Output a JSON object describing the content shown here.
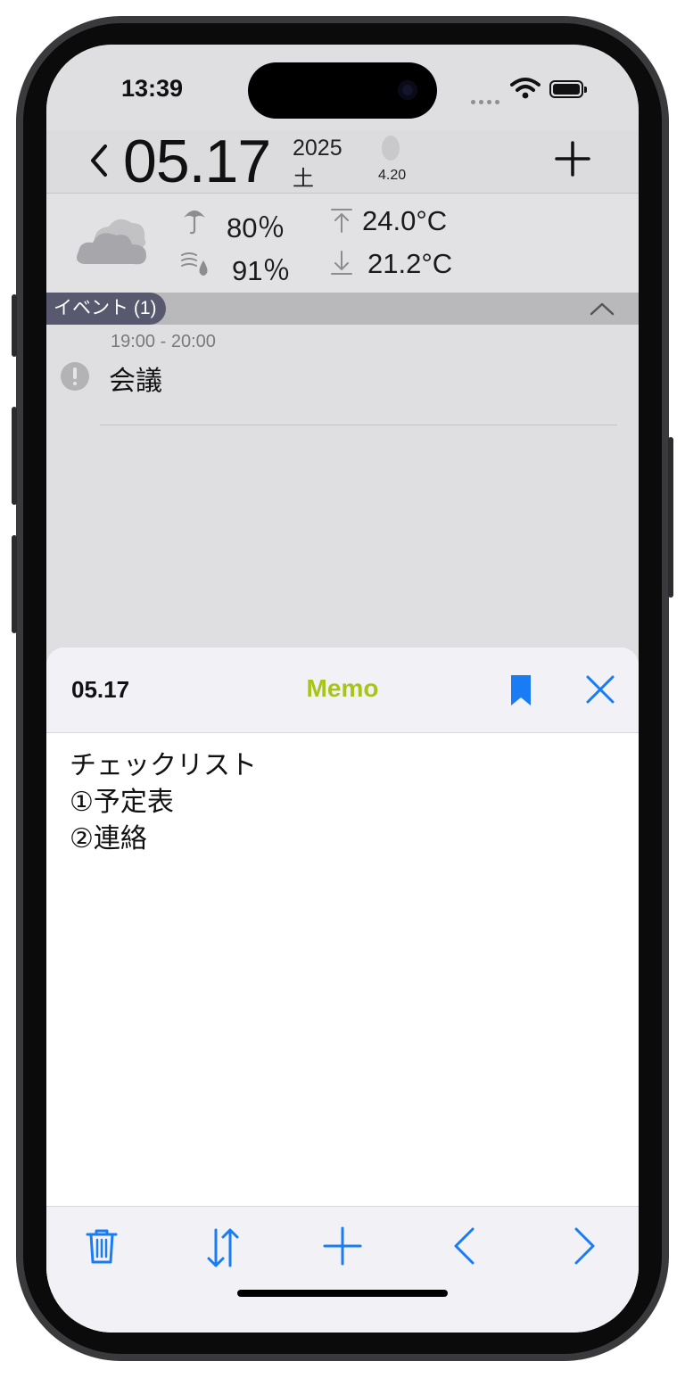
{
  "status_bar": {
    "time": "13:39"
  },
  "header": {
    "date": "05.17",
    "year": "2025",
    "weekday": "土",
    "moon_age": "4.20"
  },
  "weather": {
    "precipitation": "80％",
    "humidity": "91％",
    "temp_high": "24.0°C",
    "temp_low": "21.2°C"
  },
  "events": {
    "section_label": "イベント (1)",
    "items": [
      {
        "time": "19:00 - 20:00",
        "title": "会議"
      }
    ]
  },
  "memo_sheet": {
    "date": "05.17",
    "title": "Memo",
    "lines": [
      "チェックリスト",
      "①予定表",
      "②連絡"
    ]
  },
  "colors": {
    "accent_blue": "#1a7cf5",
    "memo_title": "#a8c41a",
    "event_pill": "#58596e"
  }
}
